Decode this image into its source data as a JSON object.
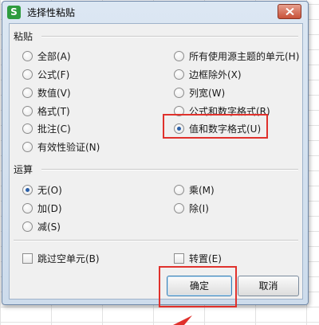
{
  "dialog": {
    "title": "选择性粘贴",
    "app_icon": "S",
    "close_icon": "close-icon"
  },
  "paste": {
    "label": "粘贴",
    "left_options": [
      "全部(A)",
      "公式(F)",
      "数值(V)",
      "格式(T)",
      "批注(C)",
      "有效性验证(N)"
    ],
    "right_options": [
      "所有使用源主题的单元(H)",
      "边框除外(X)",
      "列宽(W)",
      "公式和数字格式(R)",
      "值和数字格式(U)"
    ],
    "selected": "值和数字格式(U)"
  },
  "operation": {
    "label": "运算",
    "left_options": [
      "无(O)",
      "加(D)",
      "减(S)"
    ],
    "right_options": [
      "乘(M)",
      "除(I)"
    ],
    "selected": "无(O)"
  },
  "checkboxes": {
    "skip_blanks": "跳过空单元(B)",
    "transpose": "转置(E)"
  },
  "buttons": {
    "ok": "确定",
    "cancel": "取消"
  },
  "annotation_color": "#e0312c"
}
